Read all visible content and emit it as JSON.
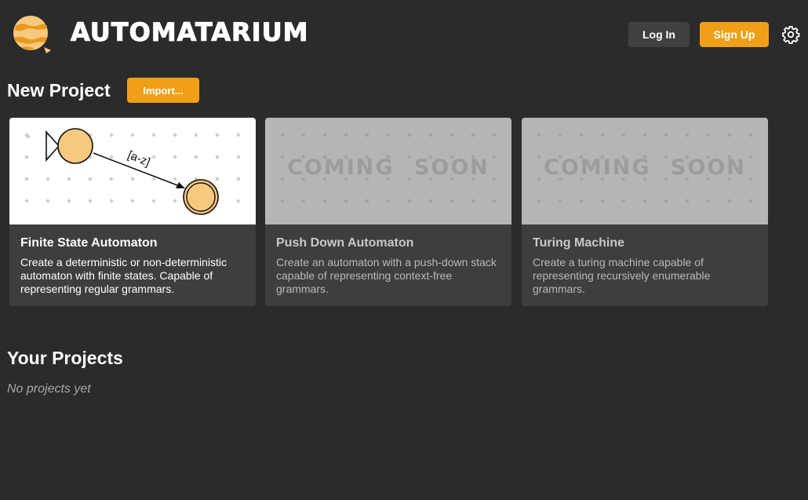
{
  "header": {
    "brand": "AUTOMATARIUM",
    "logo_icon": "planet-logo-icon",
    "login_label": "Log In",
    "signup_label": "Sign Up",
    "settings_icon": "gear-icon"
  },
  "new_project": {
    "title": "New Project",
    "import_label": "Import...",
    "cards": [
      {
        "title": "Finite State Automaton",
        "description": "Create a deterministic or non-deterministic automaton with finite states. Capable of representing regular grammars.",
        "transition_label": "[a-z]",
        "enabled": true
      },
      {
        "title": "Push Down Automaton",
        "description": "Create an automaton with a push-down stack capable of representing context-free grammars.",
        "overlay": "COMING SOON",
        "enabled": false
      },
      {
        "title": "Turing Machine",
        "description": "Create a turing machine capable of representing recursively enumerable grammars.",
        "overlay": "COMING SOON",
        "enabled": false
      }
    ]
  },
  "your_projects": {
    "title": "Your Projects",
    "empty_text": "No projects yet"
  },
  "colors": {
    "background": "#2b2b2b",
    "accent": "#f0a018",
    "card": "#3e3e3e",
    "state_fill": "#f7c97e"
  }
}
